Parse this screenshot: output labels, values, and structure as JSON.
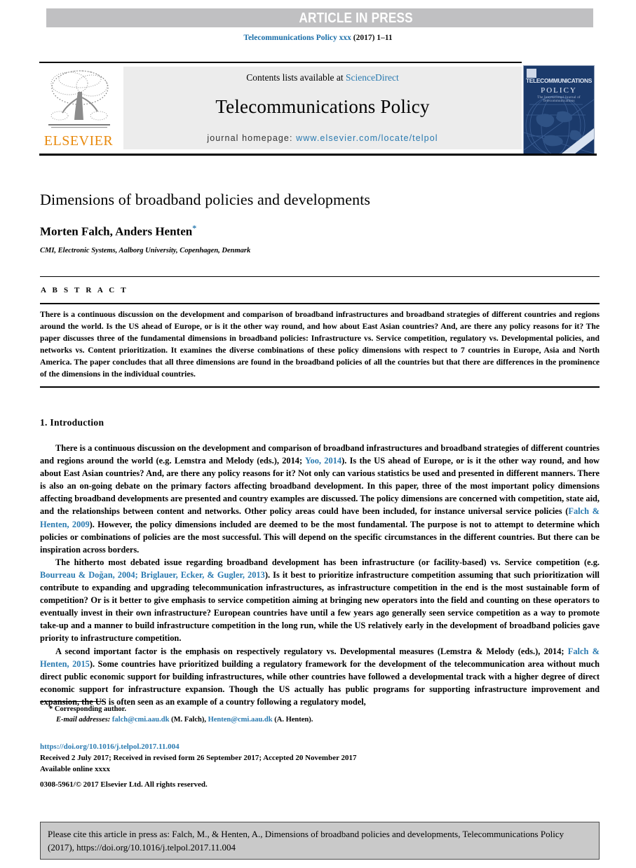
{
  "banner": {
    "text": "ARTICLE IN PRESS"
  },
  "journal_ref": {
    "name": "Telecommunications Policy xxx",
    "volume": "(2017) 1–11"
  },
  "masthead": {
    "contents_prefix": "Contents lists available at ",
    "sciencedirect": "ScienceDirect",
    "journal_name": "Telecommunications Policy",
    "homepage_label": "journal homepage: ",
    "homepage_url": "www.elsevier.com/locate/telpol",
    "publisher_logo": "ELSEVIER",
    "cover": {
      "title": "TELECOMMUNICATIONS",
      "subtitle": "POLICY",
      "tagline": "The International Journal of Telecommunications"
    }
  },
  "article": {
    "title": "Dimensions of broadband policies and developments",
    "authors": "Morten Falch, Anders Henten",
    "corresponding_marker": "*",
    "affiliation": "CMI, Electronic Systems, Aalborg University, Copenhagen, Denmark"
  },
  "abstract": {
    "label": "A B S T R A C T",
    "text": "There is a continuous discussion on the development and comparison of broadband infrastructures and broadband strategies of different countries and regions around the world. Is the US ahead of Europe, or is it the other way round, and how about East Asian countries? And, are there any policy reasons for it? The paper discusses three of the fundamental dimensions in broadband policies: Infrastructure vs. Service competition, regulatory vs. Developmental policies, and networks vs. Content prioritization. It examines the diverse combinations of these policy dimensions with respect to 7 countries in Europe, Asia and North America. The paper concludes that all three dimensions are found in the broadband policies of all the countries but that there are differences in the prominence of the dimensions in the individual countries."
  },
  "section": {
    "heading": "1. Introduction",
    "paragraphs": [
      {
        "parts": [
          {
            "t": "There is a continuous discussion on the development and comparison of broadband infrastructures and broadband strategies of different countries and regions around the world (e.g. Lemstra and Melody (eds.), 2014; ",
            "link": false
          },
          {
            "t": "Yoo, 2014",
            "link": true
          },
          {
            "t": "). Is the US ahead of Europe, or is it the other way round, and how about East Asian countries? And, are there any policy reasons for it? Not only can various statistics be used and presented in different manners. There is also an on-going debate on the primary factors affecting broadband development. In this paper, three of the most important policy dimensions affecting broadband developments are presented and country examples are discussed. The policy dimensions are concerned with competition, state aid, and the relationships between content and networks. Other policy areas could have been included, for instance universal service policies (",
            "link": false
          },
          {
            "t": "Falch & Henten, 2009",
            "link": true
          },
          {
            "t": "). However, the policy dimensions included are deemed to be the most fundamental. The purpose is not to attempt to determine which policies or combinations of policies are the most successful. This will depend on the specific circumstances in the different countries. But there can be inspiration across borders.",
            "link": false
          }
        ]
      },
      {
        "parts": [
          {
            "t": "The hitherto most debated issue regarding broadband development has been infrastructure (or facility-based) vs. Service competition (e.g. ",
            "link": false
          },
          {
            "t": "Bourreau & Doğan, 2004; Briglauer, Ecker, & Gugler, 2013",
            "link": true
          },
          {
            "t": "). Is it best to prioritize infrastructure competition assuming that such prioritization will contribute to expanding and upgrading telecommunication infrastructures, as infrastructure competition in the end is the most sustainable form of competition? Or is it better to give emphasis to service competition aiming at bringing new operators into the field and counting on these operators to eventually invest in their own infrastructure? European countries have until a few years ago generally seen service competition as a way to promote take-up and a manner to build infrastructure competition in the long run, while the US relatively early in the development of broadband policies gave priority to infrastructure competition.",
            "link": false
          }
        ]
      },
      {
        "parts": [
          {
            "t": "A second important factor is the emphasis on respectively regulatory vs. Developmental measures (Lemstra & Melody (eds.), 2014; ",
            "link": false
          },
          {
            "t": "Falch & Henten, 2015",
            "link": true
          },
          {
            "t": "). Some countries have prioritized building a regulatory framework for the development of the telecommunication area without much direct public economic support for building infrastructures, while other countries have followed a developmental track with a higher degree of direct economic support for infrastructure expansion. Though the US actually has public programs for supporting infrastructure improvement and expansion, the US is often seen as an example of a country following a regulatory model,",
            "link": false
          }
        ]
      }
    ]
  },
  "footnotes": {
    "corresponding": "*  Corresponding author.",
    "email_label": "E-mail addresses:",
    "email1": "falch@cmi.aau.dk",
    "email1_owner": "(M. Falch),",
    "email2": "Henten@cmi.aau.dk",
    "email2_owner": "(A. Henten)."
  },
  "footer": {
    "doi": "https://doi.org/10.1016/j.telpol.2017.11.004",
    "history": "Received 2 July 2017; Received in revised form 26 September 2017; Accepted 20 November 2017",
    "available": "Available online xxxx",
    "issn": "0308-5961/© 2017 Elsevier Ltd. All rights reserved."
  },
  "cite_box": {
    "text": "Please cite this article in press as: Falch, M., & Henten, A., Dimensions of broadband policies and developments, Telecommunications Policy (2017), https://doi.org/10.1016/j.telpol.2017.11.004"
  },
  "colors": {
    "link": "#2a7ab0",
    "banner_bg": "#c0c0c2",
    "masthead_bg": "#ececec",
    "elsevier_orange": "#e8890c",
    "cover_navy": "#1b3a6b",
    "cite_box_bg": "#c9c9c9"
  }
}
